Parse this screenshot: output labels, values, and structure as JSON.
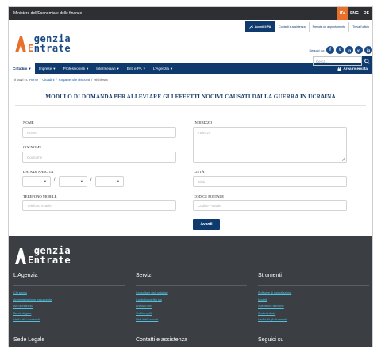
{
  "topbar": {
    "ministry": "Ministero dell'Economia e delle finanze",
    "languages": [
      "ITA",
      "ENG",
      "DE"
    ]
  },
  "header": {
    "logo": {
      "line1_first": "A",
      "line1_rest": "genzia",
      "line2_first": "E",
      "line2_rest": "ntrate"
    },
    "area_riservata_btn": "Accedi il PA",
    "service_links": [
      "Contatti e assistenza",
      "Prenota un appuntamento",
      "Trova l'ufficio"
    ],
    "social_label": "Seguici su:",
    "social": [
      "f",
      "t",
      "in",
      "yt",
      "ig"
    ],
    "search_placeholder": "Cerca..."
  },
  "nav": {
    "items": [
      {
        "label": "Cittadini",
        "active": true
      },
      {
        "label": "Imprese",
        "active": false
      },
      {
        "label": "Professionisti",
        "active": false
      },
      {
        "label": "Intermediari",
        "active": false
      },
      {
        "label": "Enti e PA",
        "active": false
      },
      {
        "label": "L'Agenzia",
        "active": false
      }
    ],
    "reserved_area": "Area riservata"
  },
  "breadcrumb": {
    "prefix": "Ti trovi in:",
    "items": [
      "Home",
      "Cittadini",
      "Pagamenti e rimborsi"
    ],
    "current": "Richiesta"
  },
  "form": {
    "title": "MODULO DI DOMANDA PER ALLEVIARE GLI EFFETTI NOCIVI CAUSATI DALLA GUERRA IN UCRAINA",
    "nome_label": "NOME",
    "nome_placeholder": "Nome",
    "cognome_label": "COGNOME",
    "cognome_placeholder": "Cognome",
    "data_label": "DATA DI NASCITA",
    "day_value": "--",
    "month_value": "--",
    "year_value": "----",
    "telefono_label": "TELEFONO MOBILE",
    "telefono_placeholder": "Telefono mobile",
    "indirizzo_label": "INDIRIZZO",
    "indirizzo_placeholder": "Indirizzo",
    "citta_label": "CITTÀ",
    "citta_placeholder": "Città",
    "cap_label": "CODICE POSTALE",
    "cap_placeholder": "Codice Postale",
    "submit": "Avanti"
  },
  "footer": {
    "columns": [
      {
        "title": "L'Agenzia",
        "links": [
          "Chi siamo",
          "Amministrazione trasparente",
          "Atti di indirizzo",
          "Bandi di gara",
          "Vedi tutti i contenuti"
        ]
      },
      {
        "title": "Servizi",
        "links": [
          "Consultare dati catastali",
          "Controllo partita iva",
          "Archivio libri",
          "Verifica gdfb",
          "Vedi tutti i servizi"
        ]
      },
      {
        "title": "Strumenti",
        "links": [
          "Software di compilazione",
          "Modelli",
          "Specifiche tecniche",
          "Codici tributo",
          "Vedi tutti gli strumenti"
        ]
      }
    ],
    "bottom": [
      "Sede Legale",
      "Contatti e assistenza",
      "Seguici su"
    ]
  },
  "colors": {
    "brand_blue": "#0e3a6e",
    "orange": "#e8702a",
    "footer_bg": "#3b3e43",
    "link_cyan": "#4ec0e0"
  }
}
